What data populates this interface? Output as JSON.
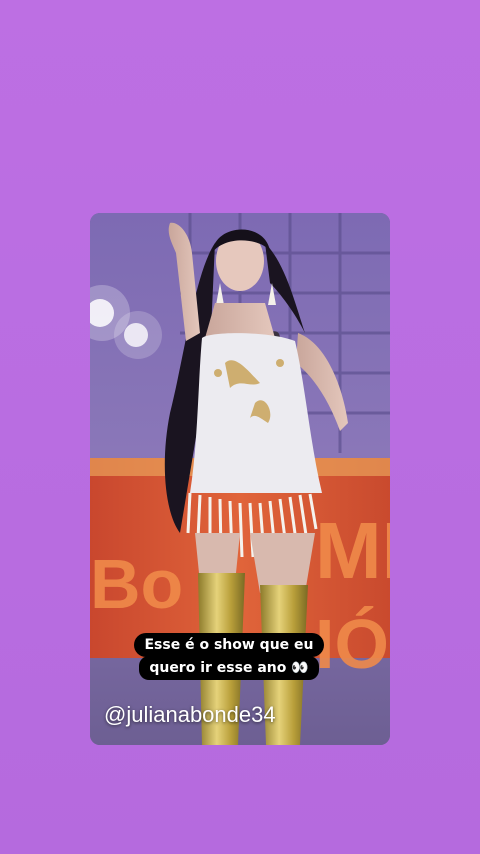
{
  "story": {
    "background_color": "#bd6fe3",
    "caption": {
      "line1": "Esse é o show que eu",
      "line2": "quero ir esse ano 👀"
    },
    "username_watermark": "@julianabonde34",
    "media": {
      "icon": "concert-performer-photo",
      "stage_sign_text": "BOME"
    }
  }
}
